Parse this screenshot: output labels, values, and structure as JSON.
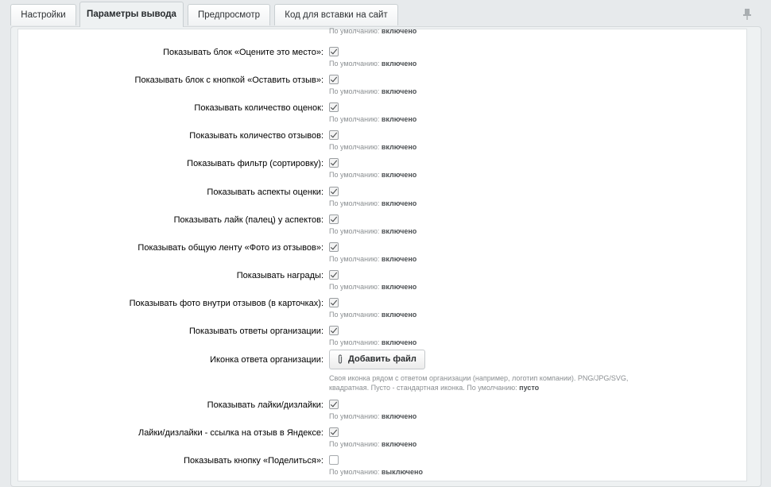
{
  "tabs": [
    "Настройки",
    "Параметры вывода",
    "Предпросмотр",
    "Код для вставки на сайт"
  ],
  "active_tab": "Параметры вывода",
  "default_prefix": "По умолчанию:",
  "top_partial_hint": "включено",
  "rows": [
    {
      "label": "Показывать блок «Оцените это место»:",
      "checked": true,
      "default": "включено"
    },
    {
      "label": "Показывать блок с кнопкой «Оставить отзыв»:",
      "checked": true,
      "default": "включено"
    },
    {
      "label": "Показывать количество оценок:",
      "checked": true,
      "default": "включено"
    },
    {
      "label": "Показывать количество отзывов:",
      "checked": true,
      "default": "включено"
    },
    {
      "label": "Показывать фильтр (сортировку):",
      "checked": true,
      "default": "включено"
    },
    {
      "label": "Показывать аспекты оценки:",
      "checked": true,
      "default": "включено"
    },
    {
      "label": "Показывать лайк (палец) у аспектов:",
      "checked": true,
      "default": "включено"
    },
    {
      "label": "Показывать общую ленту «Фото из отзывов»:",
      "checked": true,
      "default": "включено"
    },
    {
      "label": "Показывать награды:",
      "checked": true,
      "default": "включено"
    },
    {
      "label": "Показывать фото внутри отзывов (в карточках):",
      "checked": true,
      "default": "включено"
    },
    {
      "label": "Показывать ответы организации:",
      "checked": true,
      "default": "включено"
    }
  ],
  "icon_row": {
    "label": "Иконка ответа организации:",
    "button": "Добавить файл",
    "desc_line1": "Своя иконка рядом с ответом организации (например, логотип компании). PNG/JPG/SVG,",
    "desc_line2": "квадратная. Пусто - стандартная иконка. По умолчанию:",
    "desc_default": "пусто"
  },
  "rows2": [
    {
      "label": "Показывать лайки/дизлайки:",
      "checked": true,
      "default": "включено"
    },
    {
      "label": "Лайки/дизлайки - ссылка на отзыв в Яндексе:",
      "checked": true,
      "default": "включено"
    },
    {
      "label": "Показывать кнопку «Поделиться»:",
      "checked": false,
      "default": "выключено"
    }
  ]
}
